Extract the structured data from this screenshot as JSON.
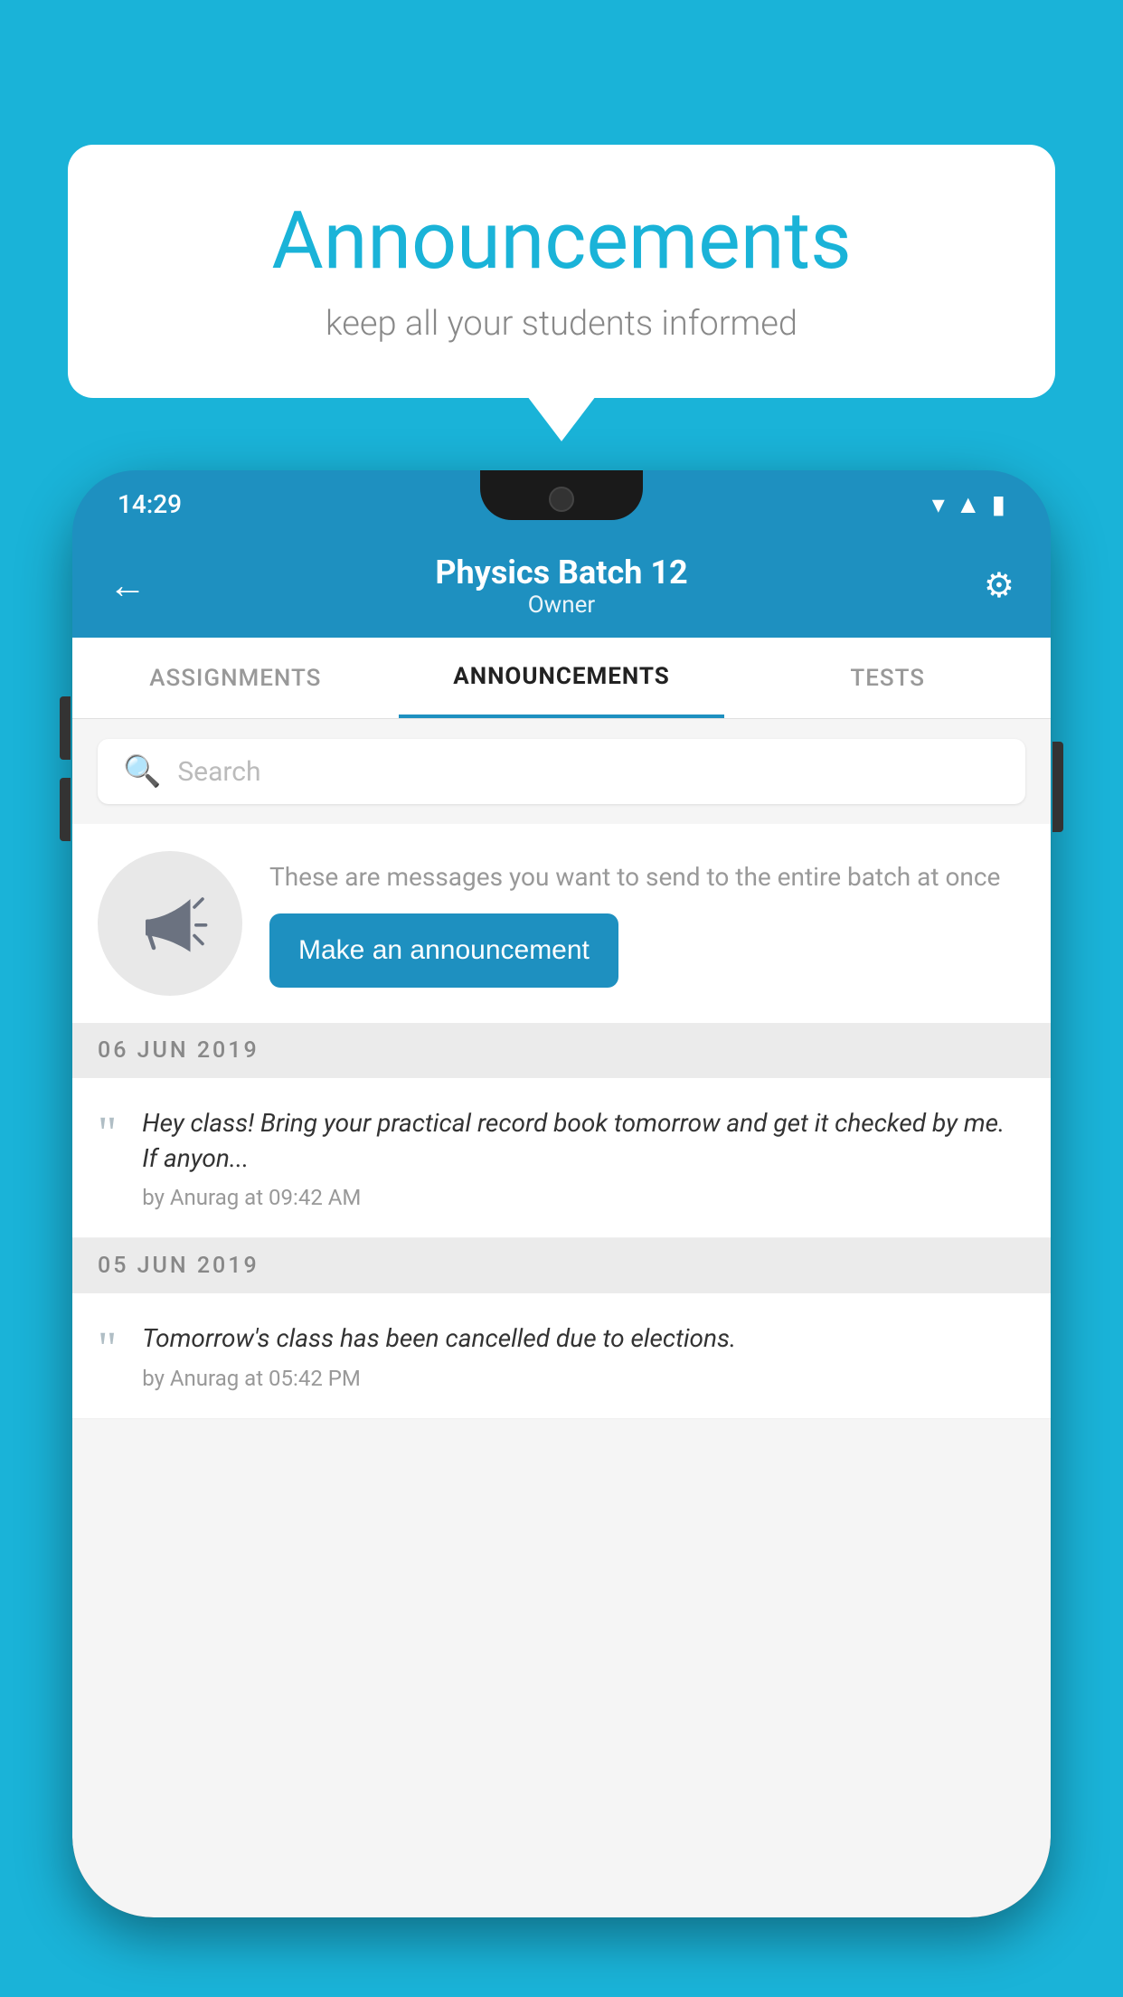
{
  "bubble": {
    "title": "Announcements",
    "subtitle": "keep all your students informed"
  },
  "phone": {
    "statusBar": {
      "time": "14:29"
    },
    "appBar": {
      "title": "Physics Batch 12",
      "subtitle": "Owner",
      "backLabel": "←",
      "settingsLabel": "⚙"
    },
    "tabs": [
      {
        "label": "ASSIGNMENTS",
        "active": false
      },
      {
        "label": "ANNOUNCEMENTS",
        "active": true
      },
      {
        "label": "TESTS",
        "active": false
      }
    ],
    "search": {
      "placeholder": "Search"
    },
    "promo": {
      "text": "These are messages you want to send to the entire batch at once",
      "buttonLabel": "Make an announcement"
    },
    "announcements": [
      {
        "date": "06  JUN  2019",
        "text": "Hey class! Bring your practical record book tomorrow and get it checked by me. If anyon...",
        "author": "by Anurag at 09:42 AM"
      },
      {
        "date": "05  JUN  2019",
        "text": "Tomorrow's class has been cancelled due to elections.",
        "author": "by Anurag at 05:42 PM"
      }
    ]
  }
}
